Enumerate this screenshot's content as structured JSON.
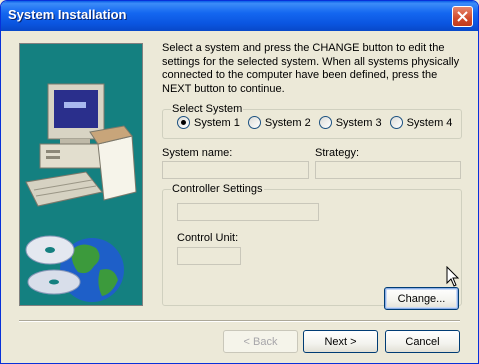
{
  "window": {
    "title": "System Installation"
  },
  "instructions": "Select a system and press the CHANGE button to edit the settings for the selected system. When all systems physically connected to the computer have been defined, press the NEXT button to continue.",
  "select_system": {
    "legend": "Select System",
    "options": [
      "System 1",
      "System 2",
      "System 3",
      "System 4"
    ],
    "selected": "System 1"
  },
  "fields": {
    "system_name_label": "System name:",
    "system_name_value": "",
    "strategy_label": "Strategy:",
    "strategy_value": ""
  },
  "controller": {
    "legend": "Controller Settings",
    "controller_value": "",
    "control_unit_label": "Control Unit:",
    "control_unit_value": ""
  },
  "buttons": {
    "change": "Change...",
    "back": "< Back",
    "next": "Next >",
    "cancel": "Cancel"
  },
  "icons": [
    "close-icon",
    "computer-illustration",
    "cd-disc-icon",
    "globe-icon",
    "mouse-pointer-icon"
  ]
}
